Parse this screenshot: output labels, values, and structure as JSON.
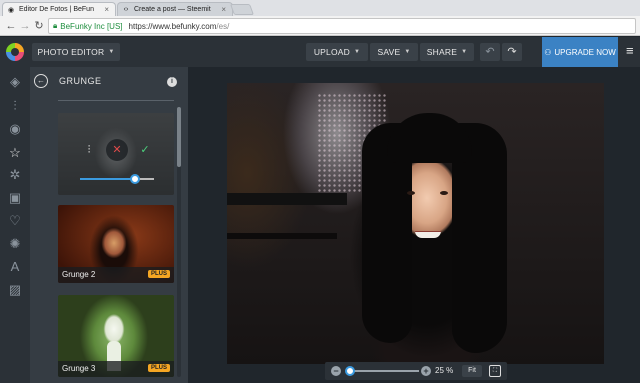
{
  "browser": {
    "tabs": [
      {
        "label": "Editor De Fotos | BeFun",
        "active": true
      },
      {
        "label": "Create a post — Steemit",
        "active": false
      }
    ],
    "secure_label": "BeFunky Inc [US]",
    "url_host": "https://www.befunky.com",
    "url_path": "/es/"
  },
  "header": {
    "photo_editor_label": "PHOTO EDITOR",
    "upload_label": "UPLOAD",
    "save_label": "SAVE",
    "share_label": "SHARE",
    "upgrade_label": "UPGRADE NOW"
  },
  "panel": {
    "title": "GRUNGE",
    "intensity": 0.74,
    "effects": [
      {
        "name": "Grunge 2",
        "badge": "PLUS"
      },
      {
        "name": "Grunge 3",
        "badge": "PLUS"
      }
    ]
  },
  "zoom": {
    "value": "25 %",
    "fit_label": "Fit"
  },
  "colors": {
    "accent": "#3b9be0",
    "upgrade": "#3b82c4",
    "badge": "#f5a623"
  }
}
